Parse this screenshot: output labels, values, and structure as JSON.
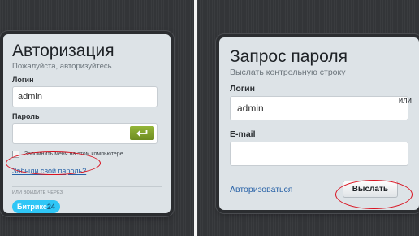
{
  "login_panel": {
    "title": "Авторизация",
    "subtitle": "Пожалуйста, авторизуйтесь",
    "login_label": "Логин",
    "login_value": "admin",
    "password_label": "Пароль",
    "password_value": "",
    "enter_icon": "enter-arrow-icon",
    "remember_label": "Запомнить меня на этом компьютере",
    "remember_checked": false,
    "forgot_link": "Забыли свой пароль?",
    "login_via": "ИЛИ ВОЙДИТЕ ЧЕРЕЗ",
    "bitrix_text": "Битрикс",
    "bitrix_num": "24"
  },
  "reset_panel": {
    "title": "Запрос пароля",
    "subtitle": "Выслать контрольную строку",
    "login_label": "Логин",
    "login_value": "admin",
    "or_label": "или",
    "email_label": "E-mail",
    "email_value": "",
    "auth_link": "Авторизоваться",
    "send_button": "Выслать"
  },
  "colors": {
    "highlight_ring": "#d9111f",
    "accent_green": "#7e9d2a",
    "link_blue": "#2862a7",
    "bitrix_blue": "#2fc6f6"
  }
}
